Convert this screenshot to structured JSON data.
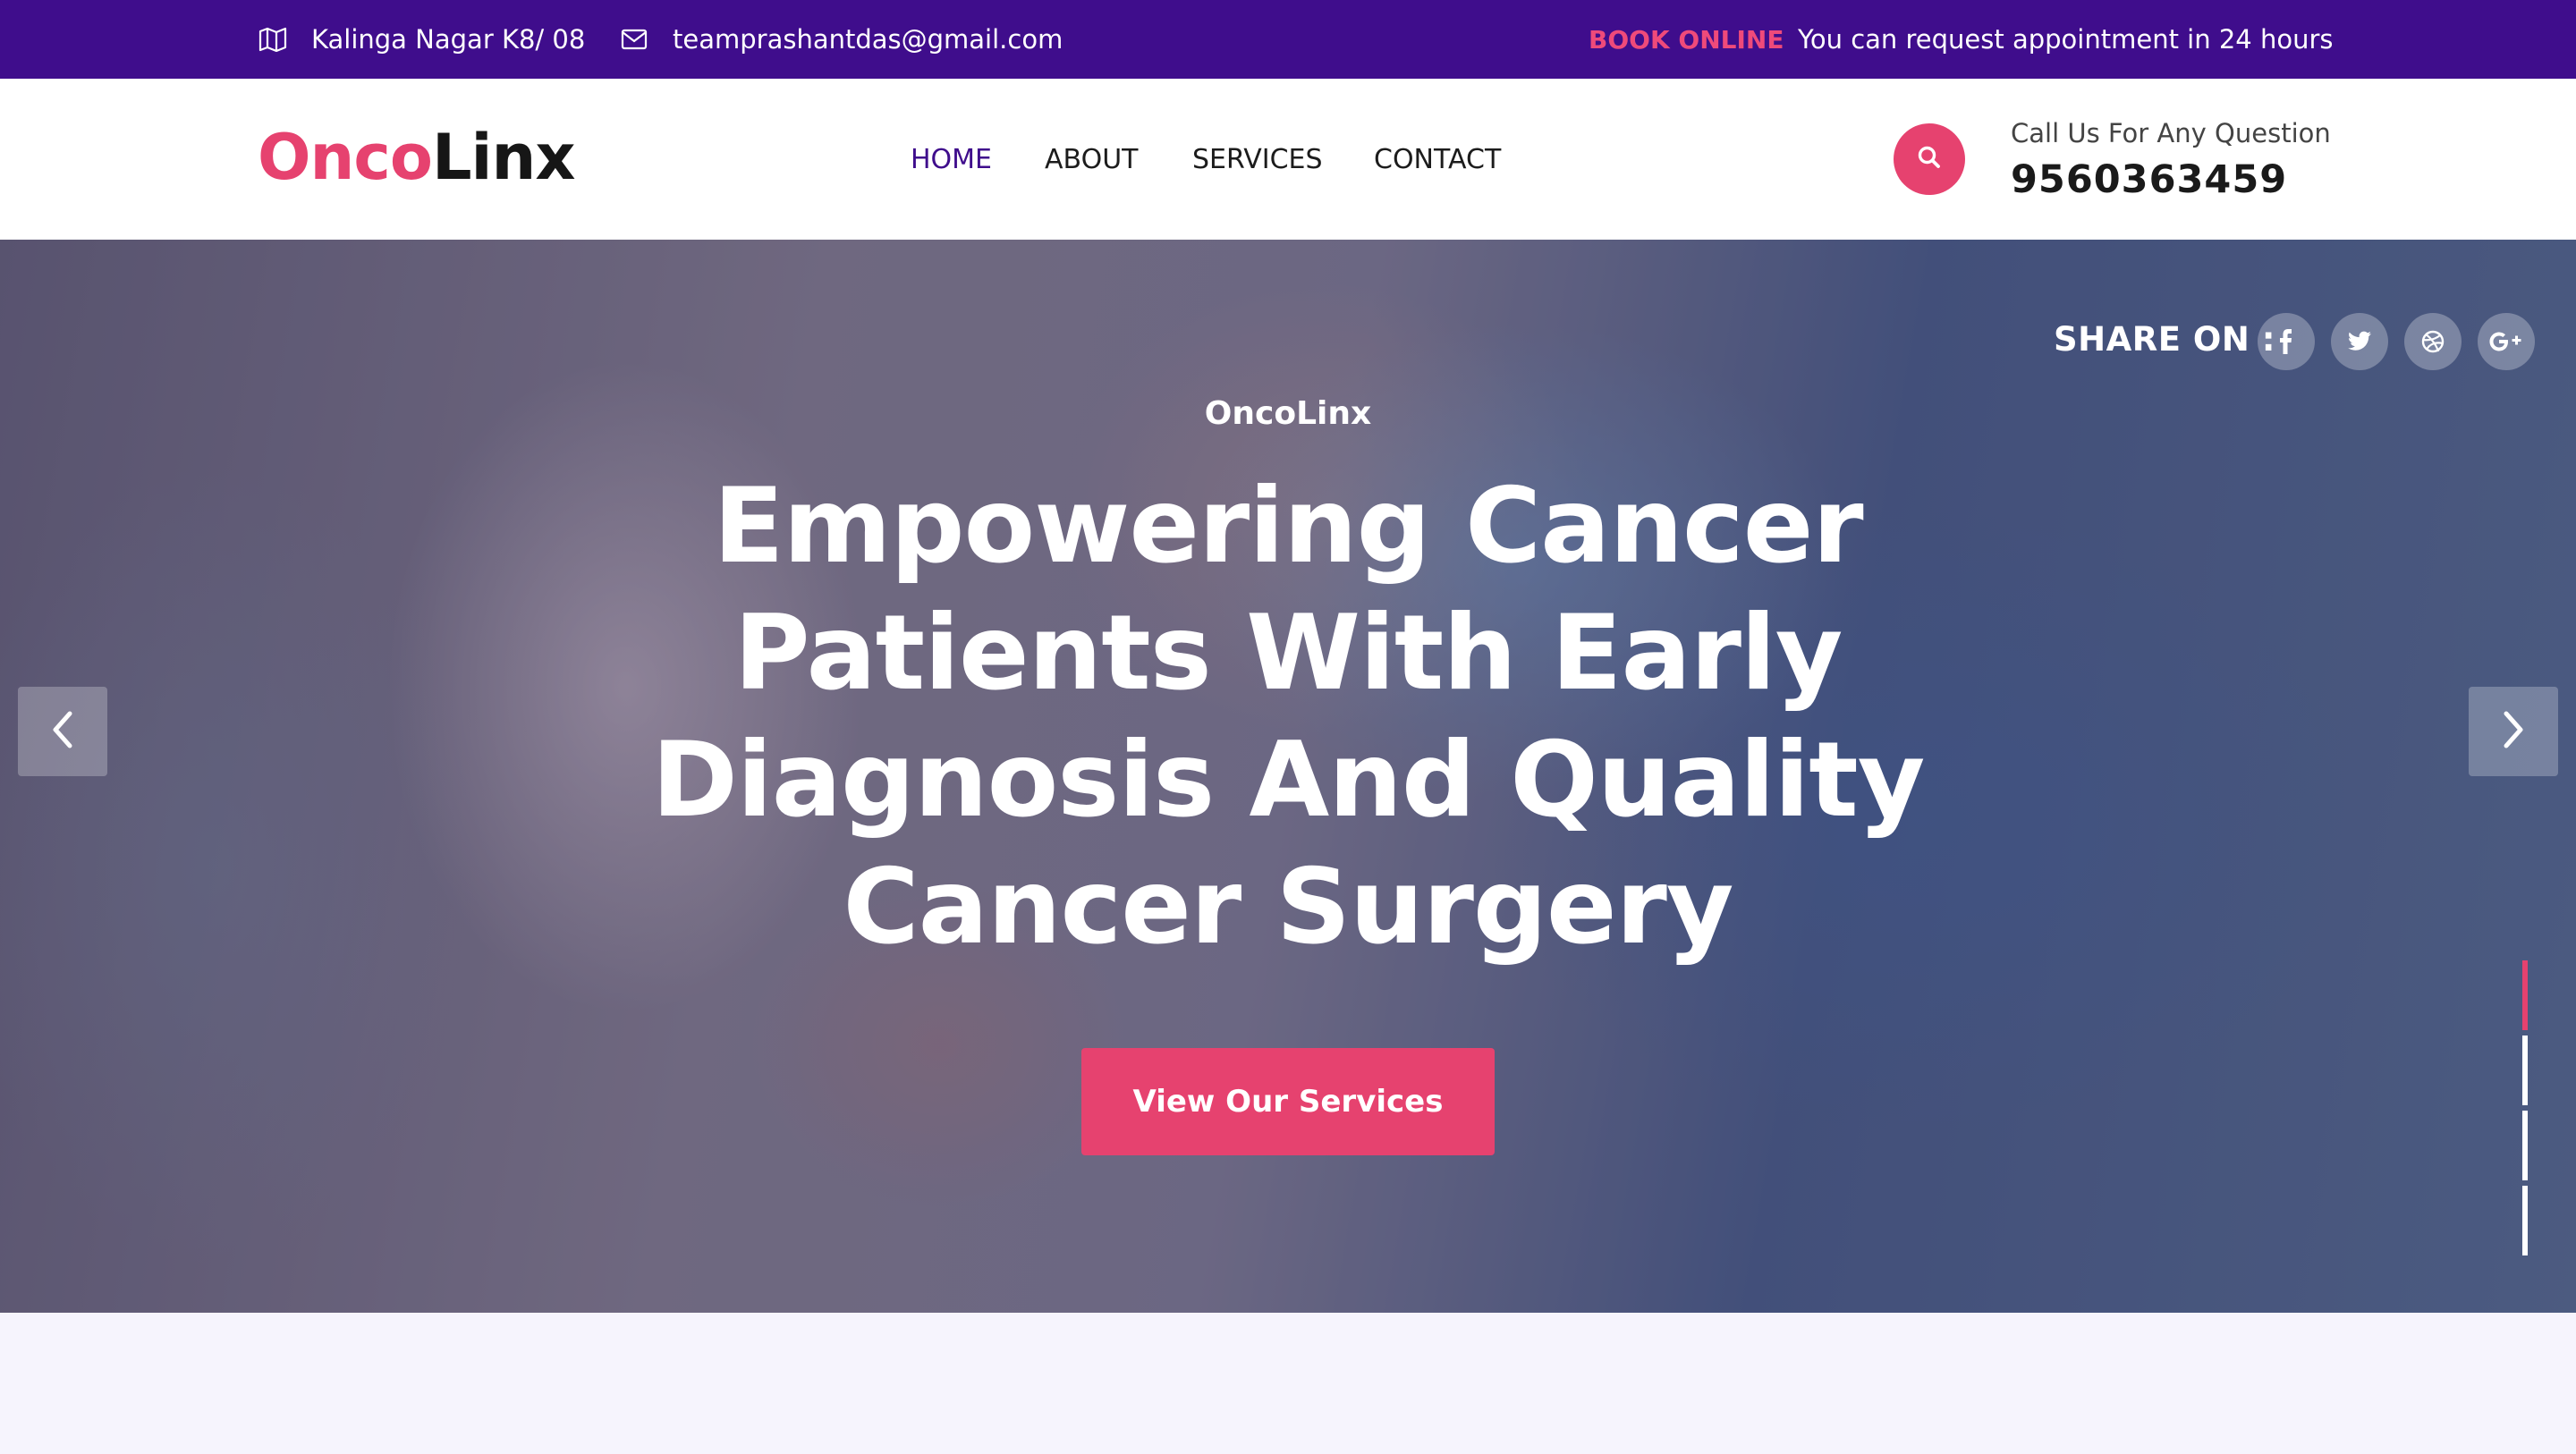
{
  "topbar": {
    "address": "Kalinga Nagar K8/ 08",
    "email": "teamprashantdas@gmail.com",
    "book_online": "BOOK ONLINE",
    "request_text": "You can request appointment in 24 hours",
    "icons": [
      "map-icon",
      "envelope-icon"
    ]
  },
  "header": {
    "logo_part1": "Onco",
    "logo_part2": "Linx",
    "nav": {
      "home": "HOME",
      "about": "ABOUT",
      "services": "SERVICES",
      "contact": "CONTACT",
      "active": "HOME"
    },
    "call_label": "Call Us For Any Question",
    "call_number": "9560363459"
  },
  "hero": {
    "share_label": "SHARE ON :",
    "social_icons": [
      "facebook-icon",
      "twitter-icon",
      "dribbble-icon",
      "google-plus-icon"
    ],
    "subtitle": "OncoLinx",
    "title": "Empowering Cancer Patients With Early Diagnosis And Quality Cancer Surgery",
    "cta_label": "View Our Services",
    "slides_total": 4,
    "active_slide": 1
  },
  "colors": {
    "topbar_bg": "#3f0d8c",
    "accent": "#e6426f",
    "nav_active": "#3f0d8c",
    "page_bg": "#f6f4fd"
  }
}
